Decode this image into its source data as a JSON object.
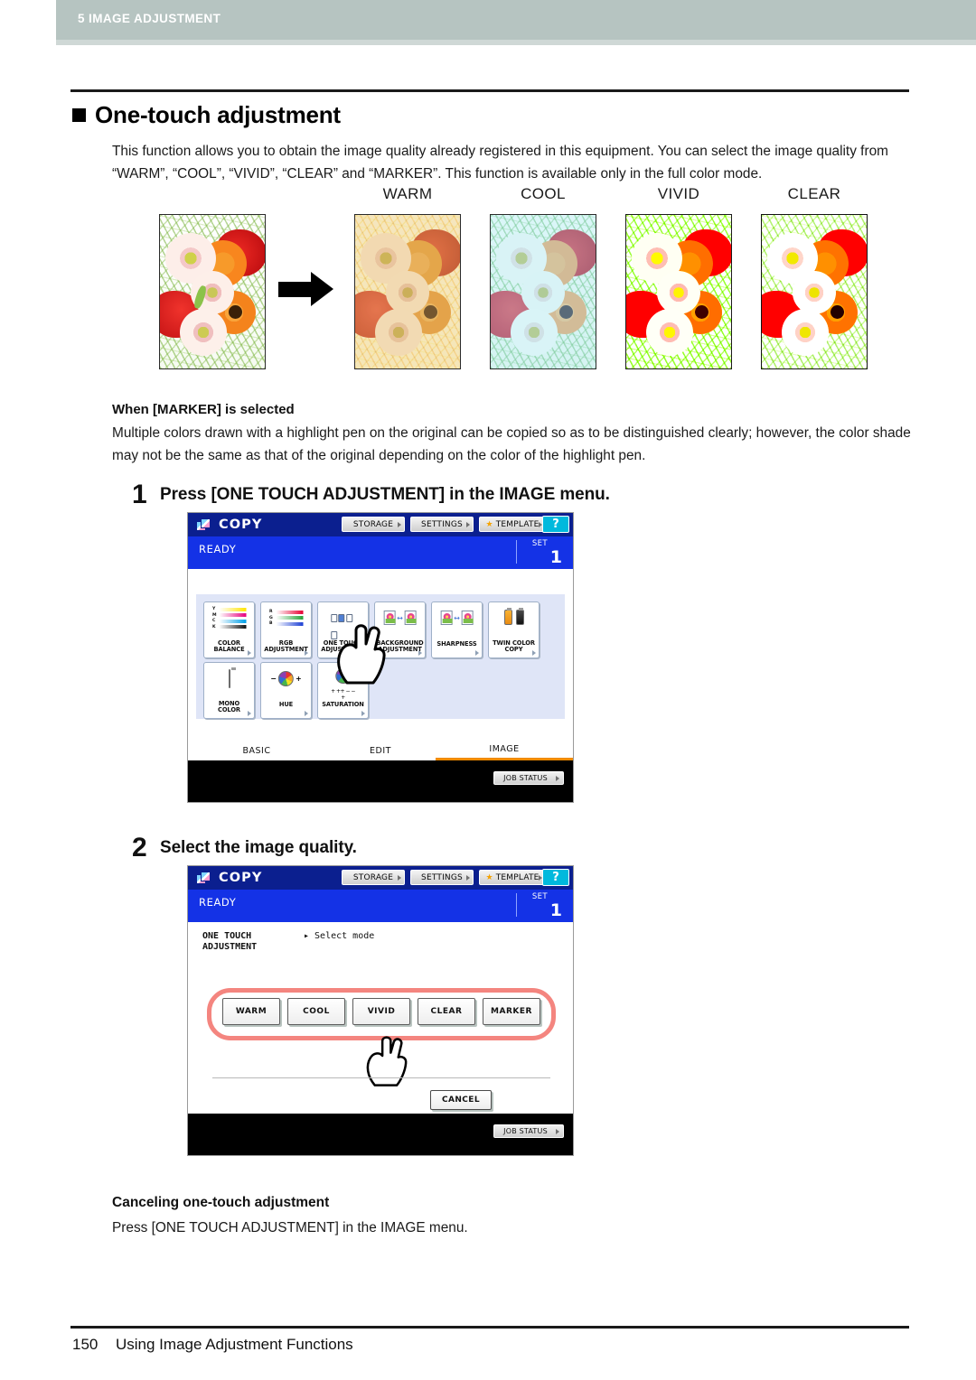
{
  "running_head": {
    "chapter": "5 IMAGE ADJUSTMENT"
  },
  "section": {
    "title": "One-touch adjustment",
    "intro": "This function allows you to obtain the image quality already registered in this equipment. You can select the image quality from “WARM”, “COOL”, “VIVID”, “CLEAR” and “MARKER”. This function is available only in the full color mode."
  },
  "samples": {
    "labels": [
      "WARM",
      "COOL",
      "VIVID",
      "CLEAR"
    ],
    "original_alt": "original photo of gerbera daisies",
    "arrow": "right-arrow"
  },
  "marker_note": {
    "heading": "When [MARKER] is selected",
    "body": "Multiple colors drawn with a highlight pen on the original can be copied so as to be distinguished clearly; however, the color shade may not be the same as that of the original depending on the color of the highlight pen."
  },
  "steps": [
    {
      "number": "1",
      "text": "Press [ONE TOUCH ADJUSTMENT] in the IMAGE menu."
    },
    {
      "number": "2",
      "text": "Select the image quality."
    }
  ],
  "panel1": {
    "app_title": "COPY",
    "top_buttons": [
      "STORAGE",
      "SETTINGS",
      "TEMPLATE"
    ],
    "help_label": "?",
    "status": "READY",
    "set_label": "SET",
    "set_value": "1",
    "functions": [
      {
        "line1": "COLOR",
        "line2": "BALANCE",
        "icon": "color-balance-icon"
      },
      {
        "line1": "RGB",
        "line2": "ADJUSTMENT",
        "icon": "rgb-adjustment-icon"
      },
      {
        "line1": "ONE TOUCH",
        "line2": "ADJUSTMENT",
        "icon": "one-touch-icon"
      },
      {
        "line1": "BACKGROUND",
        "line2": "ADJUSTMENT",
        "icon": "background-adjustment-icon"
      },
      {
        "line1": "SHARPNESS",
        "line2": "",
        "icon": "sharpness-icon"
      },
      {
        "line1": "TWIN COLOR",
        "line2": "COPY",
        "icon": "twin-color-copy-icon"
      },
      {
        "line1": "MONO",
        "line2": "COLOR",
        "icon": "mono-color-icon"
      },
      {
        "line1": "HUE",
        "line2": "",
        "icon": "hue-icon"
      },
      {
        "line1": "SATURATION",
        "line2": "",
        "icon": "saturation-icon"
      }
    ],
    "color_balance_channels": [
      "Y",
      "M",
      "C",
      "K"
    ],
    "rgb_channels": [
      "R",
      "G",
      "B"
    ],
    "tabs": [
      "BASIC",
      "EDIT",
      "IMAGE"
    ],
    "active_tab": "IMAGE",
    "job_status": "JOB STATUS"
  },
  "panel2": {
    "app_title": "COPY",
    "top_buttons": [
      "STORAGE",
      "SETTINGS",
      "TEMPLATE"
    ],
    "help_label": "?",
    "status": "READY",
    "set_label": "SET",
    "set_value": "1",
    "mode_title_line1": "ONE TOUCH",
    "mode_title_line2": "ADJUSTMENT",
    "mode_hint": "▸ Select mode",
    "quality_buttons": [
      "WARM",
      "COOL",
      "VIVID",
      "CLEAR",
      "MARKER"
    ],
    "cancel_label": "CANCEL",
    "job_status": "JOB STATUS",
    "highlight_color": "#f4857f"
  },
  "tail": {
    "heading": "Canceling one-touch adjustment",
    "body": "Press [ONE TOUCH ADJUSTMENT] in the IMAGE menu."
  },
  "footer": {
    "page_number": "150",
    "title": "Using Image Adjustment Functions"
  }
}
